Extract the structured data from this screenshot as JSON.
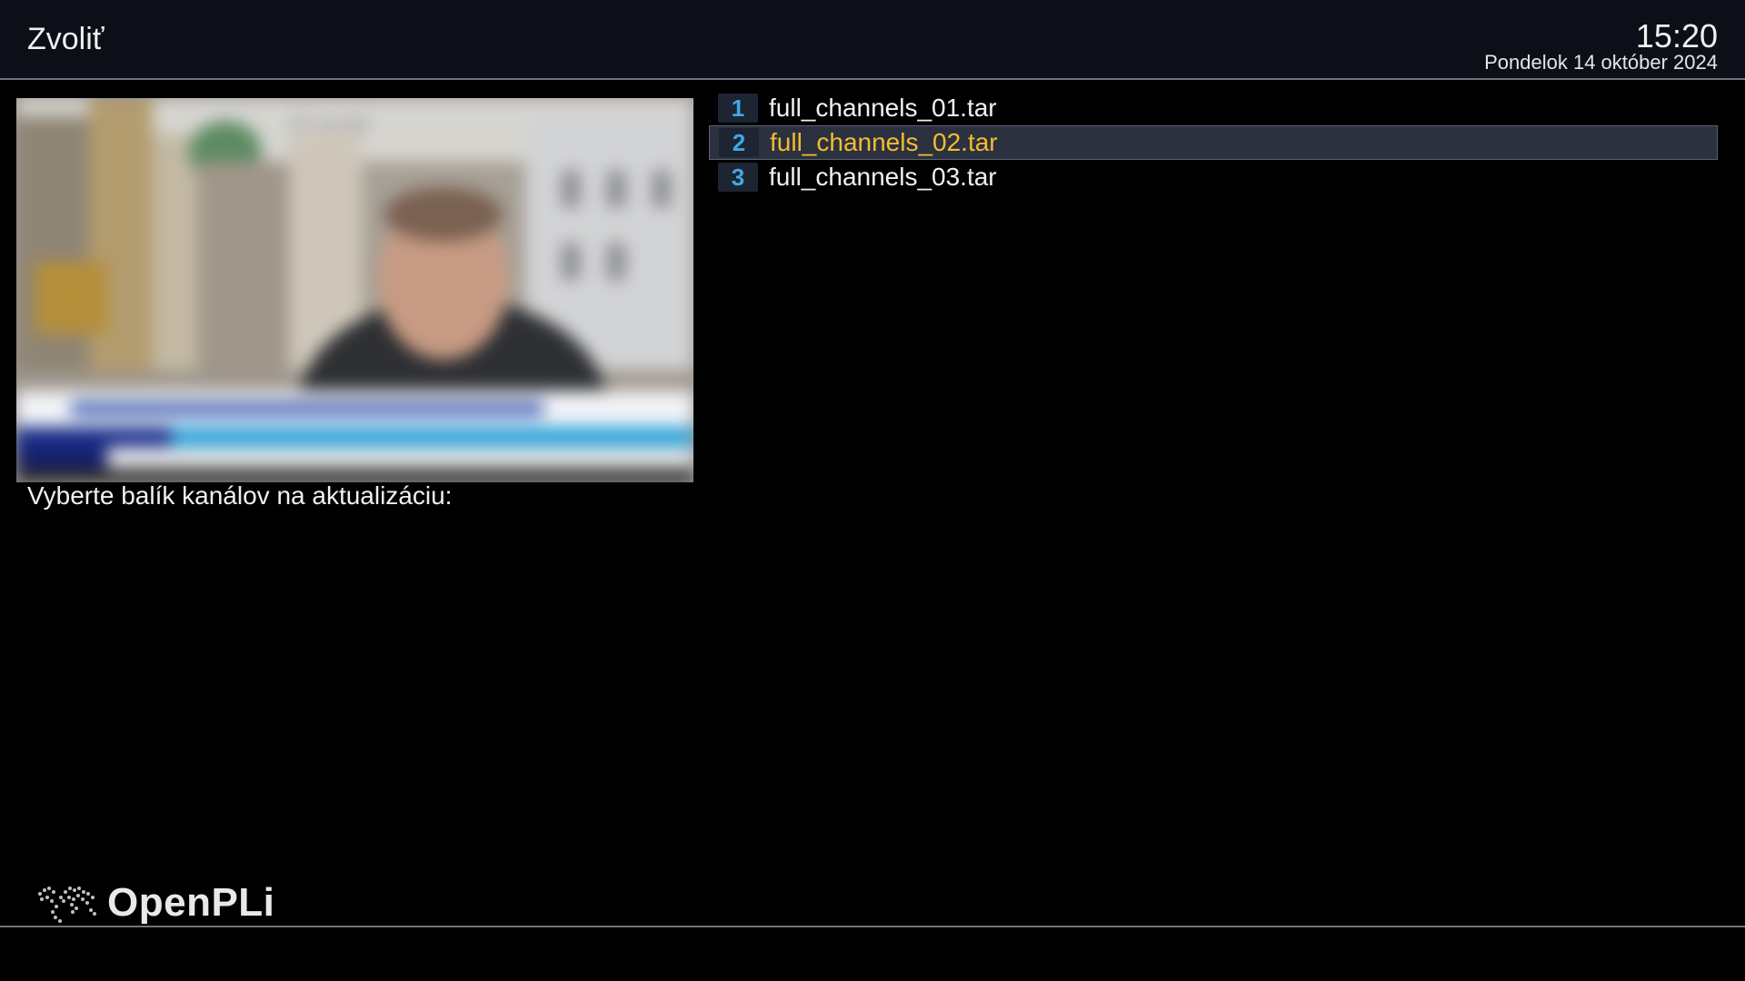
{
  "header": {
    "title": "Zvoliť",
    "time": "15:20",
    "date": "Pondelok 14 október 2024"
  },
  "preview": {
    "channel_logo": "ČT 24 HD"
  },
  "prompt": "Vyberte balík kanálov na aktualizáciu:",
  "list": {
    "selected_index": 1,
    "items": [
      {
        "number": "1",
        "name": "full_channels_01.tar"
      },
      {
        "number": "2",
        "name": "full_channels_02.tar"
      },
      {
        "number": "3",
        "name": "full_channels_03.tar"
      }
    ]
  },
  "footer": {
    "logo_text": "OpenPLi"
  },
  "colors": {
    "selected_text": "#f3bd2e",
    "number_text": "#3fa9e6",
    "header_bg": "#0c0f18"
  }
}
